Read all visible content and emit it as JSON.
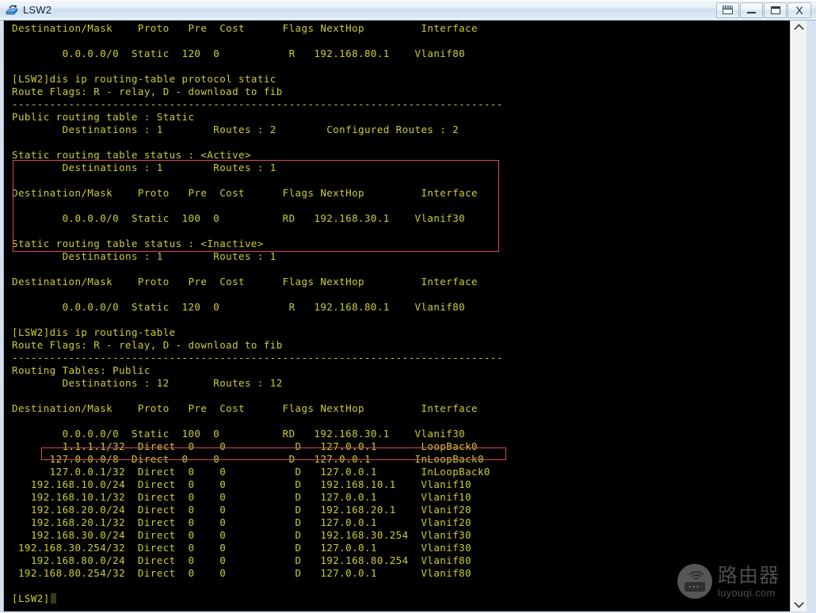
{
  "window": {
    "title": "LSW2",
    "icon": "switch-device-icon",
    "buttons": [
      {
        "name": "restore-button",
        "glyph": "restore"
      },
      {
        "name": "minimize-button",
        "glyph": "minimize"
      },
      {
        "name": "maximize-button",
        "glyph": "maximize"
      },
      {
        "name": "close-button",
        "glyph": "X"
      }
    ]
  },
  "terminal": {
    "fg_color": "#cccc33",
    "bg_color": "#000000",
    "prompt": "[LSW2]",
    "text": "Destination/Mask    Proto   Pre  Cost      Flags NextHop         Interface\n\n        0.0.0.0/0  Static  120  0           R   192.168.80.1    Vlanif80\n\n[LSW2]dis ip routing-table protocol static\nRoute Flags: R - relay, D - download to fib\n------------------------------------------------------------------------------\nPublic routing table : Static\n        Destinations : 1        Routes : 2        Configured Routes : 2\n\nStatic routing table status : <Active>\n        Destinations : 1        Routes : 1\n\nDestination/Mask    Proto   Pre  Cost      Flags NextHop         Interface\n\n        0.0.0.0/0  Static  100  0          RD   192.168.30.1    Vlanif30\n\nStatic routing table status : <Inactive>\n        Destinations : 1        Routes : 1\n\nDestination/Mask    Proto   Pre  Cost      Flags NextHop         Interface\n\n        0.0.0.0/0  Static  120  0           R   192.168.80.1    Vlanif80\n\n[LSW2]dis ip routing-table\nRoute Flags: R - relay, D - download to fib\n------------------------------------------------------------------------------\nRouting Tables: Public\n        Destinations : 12       Routes : 12\n\nDestination/Mask    Proto   Pre  Cost      Flags NextHop         Interface\n\n        0.0.0.0/0  Static  100  0          RD   192.168.30.1    Vlanif30\n        1.1.1.1/32  Direct  0    0           D   127.0.0.1       LoopBack0\n      127.0.0.0/8  Direct  0    0           D   127.0.0.1       InLoopBack0\n      127.0.0.1/32  Direct  0    0           D   127.0.0.1       InLoopBack0\n   192.168.10.0/24  Direct  0    0           D   192.168.10.1    Vlanif10\n   192.168.10.1/32  Direct  0    0           D   127.0.0.1       Vlanif10\n   192.168.20.0/24  Direct  0    0           D   192.168.20.1    Vlanif20\n   192.168.20.1/32  Direct  0    0           D   127.0.0.1       Vlanif20\n   192.168.30.0/24  Direct  0    0           D   192.168.30.254  Vlanif30\n 192.168.30.254/32  Direct  0    0           D   127.0.0.1       Vlanif30\n   192.168.80.0/24  Direct  0    0           D   192.168.80.254  Vlanif80\n 192.168.80.254/32  Direct  0    0           D   127.0.0.1       Vlanif80\n\n[LSW2]"
  },
  "highlights": {
    "color": "#d9455f",
    "boxes": [
      {
        "name": "active-static-table-highlight"
      },
      {
        "name": "default-route-row-highlight"
      }
    ]
  },
  "scrollbar": {
    "up_arrow": "scroll-up-arrow",
    "down_arrow": "scroll-down-arrow"
  },
  "watermark": {
    "cn": "路由器",
    "en": "luyouqi.com"
  }
}
